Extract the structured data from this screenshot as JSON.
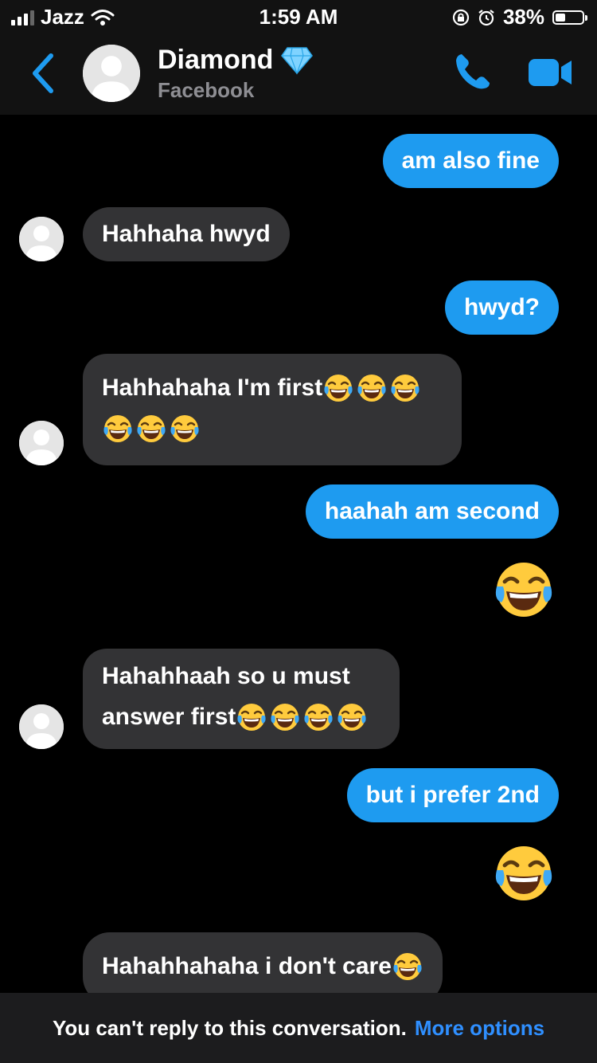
{
  "status": {
    "carrier": "Jazz",
    "time": "1:59 AM",
    "battery": "38%",
    "battery_level": 0.38
  },
  "header": {
    "name": "Diamond",
    "subtitle": "Facebook",
    "badge_icon": "diamond-icon"
  },
  "messages": {
    "m1": "am also fine",
    "m2": "Hahhaha hwyd",
    "m3": "hwyd?",
    "m4_line1": "Hahhahaha I'm first",
    "m5": "haahah  am second",
    "m6_line1": "Hahahhaah so u must",
    "m6_line2": "answer first",
    "m7": "but i prefer 2nd",
    "m8": "Hahahhahaha i don't care"
  },
  "footer": {
    "notice": "You can't reply to this conversation.",
    "link": "More options"
  },
  "colors": {
    "outgoing": "#1e9bf0",
    "incoming": "#333335",
    "link": "#2f8fff",
    "background": "#000000"
  }
}
